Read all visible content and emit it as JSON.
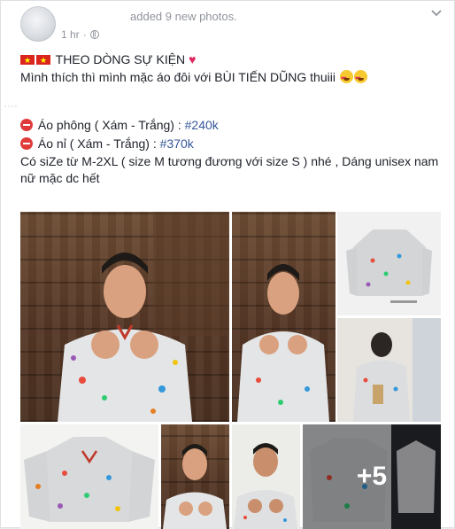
{
  "post": {
    "header": {
      "added_prefix": "added ",
      "added_link": "9 new photos",
      "added_suffix": ".",
      "timestamp": "1 hr",
      "separator": "·"
    },
    "body": {
      "line1": "THEO DÒNG SỰ KIỆN",
      "line2": "Mình thích thì mình mặc áo đôi với BÙI TIẾN DŨNG thuiii",
      "item1_text": "Áo phông ( Xám - Trắng) :",
      "item1_tag": "#240k",
      "item2_text": "Áo nỉ ( Xám - Trắng) :",
      "item2_tag": "#370k",
      "line5": "Có siZe từ M-2XL ( size M tương đương với size S ) nhé , Dáng unisex nam",
      "line6": "nữ mặc dc hết"
    },
    "photos": {
      "more_count": "+5"
    },
    "colors": {
      "link": "#365899",
      "meta_text": "#90949c",
      "body_text": "#1d2129",
      "heart": "#e0245e",
      "no_entry": "#e03b3b"
    },
    "icons": [
      "profile-avatar",
      "globe-icon",
      "chevron-down-icon",
      "vietnam-flag-icon",
      "red-heart-icon",
      "heart-eyes-emoji",
      "no-entry-icon"
    ]
  }
}
